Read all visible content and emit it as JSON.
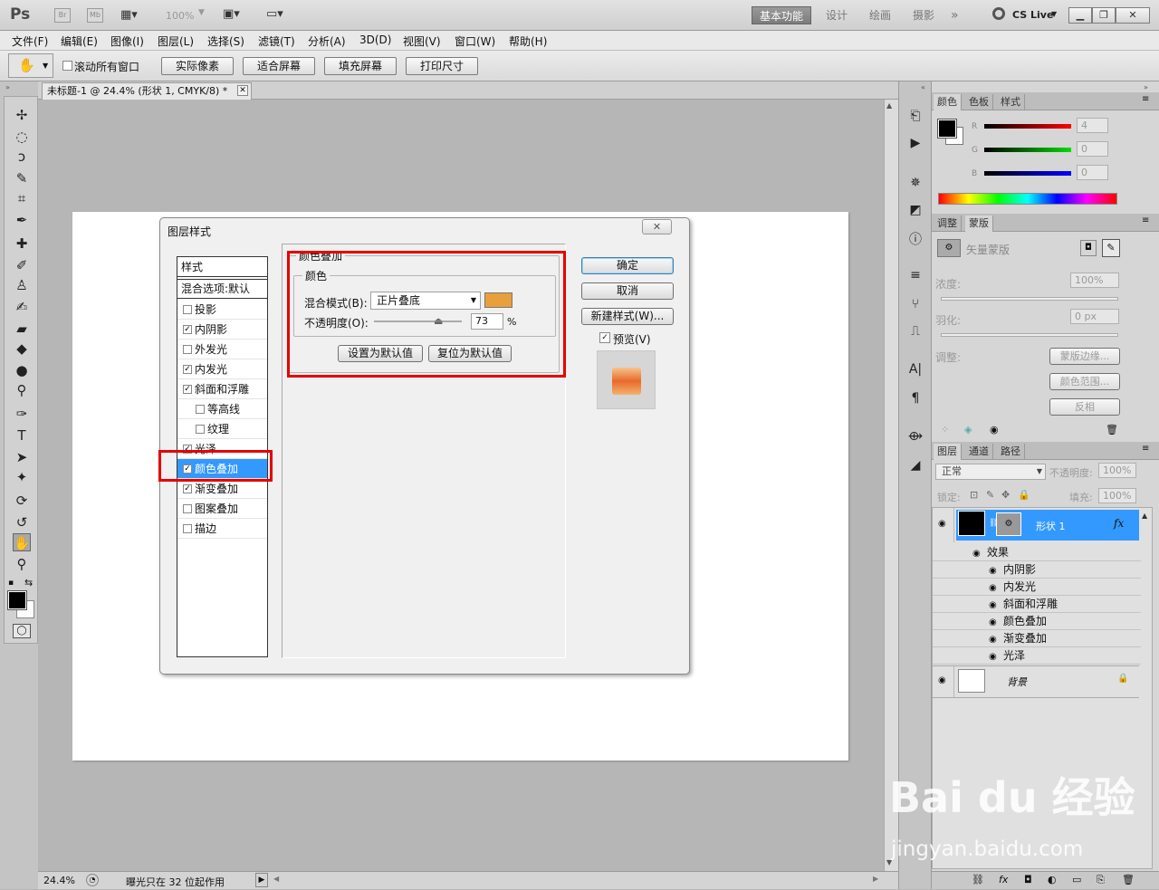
{
  "app": {
    "logo": "Ps",
    "bridge": "Br",
    "minibridge": "Mb",
    "zoom_select": "100%",
    "workspaces": [
      "基本功能",
      "设计",
      "绘画",
      "摄影"
    ],
    "more": "»",
    "cslive": "CS Live"
  },
  "menu": [
    "文件(F)",
    "编辑(E)",
    "图像(I)",
    "图层(L)",
    "选择(S)",
    "滤镜(T)",
    "分析(A)",
    "3D(D)",
    "视图(V)",
    "窗口(W)",
    "帮助(H)"
  ],
  "options": {
    "scroll_all": "滚动所有窗口",
    "buttons": [
      "实际像素",
      "适合屏幕",
      "填充屏幕",
      "打印尺寸"
    ]
  },
  "document": {
    "tab_title": "未标题-1 @ 24.4% (形状 1, CMYK/8) *",
    "zoom": "24.4%",
    "status_text": "曝光只在 32 位起作用"
  },
  "dialog": {
    "title": "图层样式",
    "list_header": "样式",
    "blend_default": "混合选项:默认",
    "items": [
      {
        "label": "投影",
        "checked": false
      },
      {
        "label": "内阴影",
        "checked": true
      },
      {
        "label": "外发光",
        "checked": false
      },
      {
        "label": "内发光",
        "checked": true
      },
      {
        "label": "斜面和浮雕",
        "checked": true
      },
      {
        "label": "等高线",
        "checked": false
      },
      {
        "label": "纹理",
        "checked": false
      },
      {
        "label": "光泽",
        "checked": true
      },
      {
        "label": "颜色叠加",
        "checked": true
      },
      {
        "label": "渐变叠加",
        "checked": true
      },
      {
        "label": "图案叠加",
        "checked": false
      },
      {
        "label": "描边",
        "checked": false
      }
    ],
    "section_title": "颜色叠加",
    "group_title": "颜色",
    "blend_mode_label": "混合模式(B):",
    "blend_mode_value": "正片叠底",
    "overlay_color": "#e8a03c",
    "opacity_label": "不透明度(O):",
    "opacity_value": "73",
    "percent": "%",
    "make_default": "设置为默认值",
    "reset_default": "复位为默认值",
    "ok": "确定",
    "cancel": "取消",
    "new_style": "新建样式(W)...",
    "preview": "预览(V)"
  },
  "color_panel": {
    "tabs": [
      "颜色",
      "色板",
      "样式"
    ],
    "channels": [
      {
        "label": "R",
        "value": "4"
      },
      {
        "label": "G",
        "value": "0"
      },
      {
        "label": "B",
        "value": "0"
      }
    ]
  },
  "mask_panel": {
    "tabs": [
      "调整",
      "蒙版"
    ],
    "mask_type": "矢量蒙版",
    "density_label": "浓度:",
    "density_value": "100%",
    "feather_label": "羽化:",
    "feather_value": "0 px",
    "adjust_label": "调整:",
    "buttons": [
      "蒙版边缘...",
      "颜色范围...",
      "反相"
    ]
  },
  "layers_panel": {
    "tabs": [
      "图层",
      "通道",
      "路径"
    ],
    "blend_mode": "正常",
    "opacity_label": "不透明度:",
    "opacity_value": "100%",
    "lock_label": "锁定:",
    "fill_label": "填充:",
    "fill_value": "100%",
    "layer_name": "形状 1",
    "fx": "fx",
    "effects_label": "效果",
    "effects": [
      "内阴影",
      "内发光",
      "斜面和浮雕",
      "颜色叠加",
      "渐变叠加",
      "光泽"
    ],
    "background": "背景"
  },
  "watermark": {
    "line1": "Bai du 经验",
    "line2": "jingyan.baidu.com"
  }
}
